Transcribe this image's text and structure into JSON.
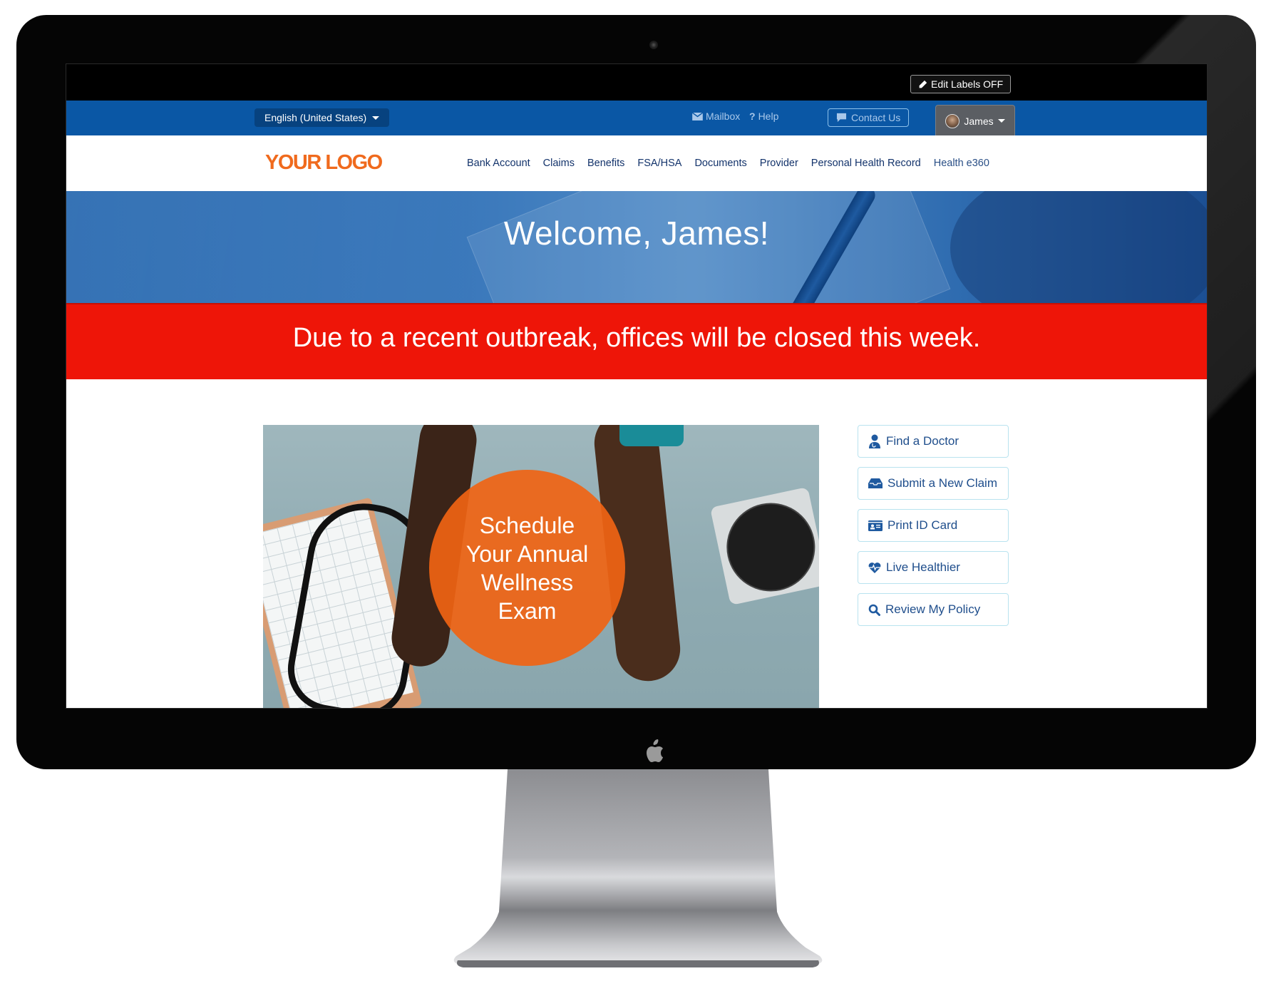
{
  "topbar": {
    "edit_labels": "Edit Labels OFF"
  },
  "utility_bar": {
    "language": "English (United States)",
    "mailbox": "Mailbox",
    "help": "Help",
    "contact_us": "Contact Us",
    "user_name": "James"
  },
  "header": {
    "logo": "YOUR LOGO",
    "nav": [
      {
        "label": "Bank Account"
      },
      {
        "label": "Claims"
      },
      {
        "label": "Benefits"
      },
      {
        "label": "FSA/HSA"
      },
      {
        "label": "Documents"
      },
      {
        "label": "Provider"
      },
      {
        "label": "Personal Health Record"
      },
      {
        "label": "Health e360"
      }
    ]
  },
  "hero": {
    "welcome": "Welcome, James!"
  },
  "alert": {
    "message": "Due to a recent outbreak, offices will be closed this week.",
    "color": "#ee1508"
  },
  "promo": {
    "lines": [
      "Schedule",
      "Your Annual",
      "Wellness",
      "Exam"
    ],
    "accent": "#f0641e"
  },
  "quick_actions": [
    {
      "label": "Find a Doctor",
      "icon": "doctor-icon"
    },
    {
      "label": "Submit a New Claim",
      "icon": "inbox-icon"
    },
    {
      "label": "Print ID Card",
      "icon": "id-card-icon"
    },
    {
      "label": "Live Healthier",
      "icon": "heartbeat-icon"
    },
    {
      "label": "Review My Policy",
      "icon": "search-icon"
    }
  ],
  "colors": {
    "brand_blue": "#0a57a5",
    "nav_text": "#13336b",
    "logo_orange": "#f06a1d"
  }
}
